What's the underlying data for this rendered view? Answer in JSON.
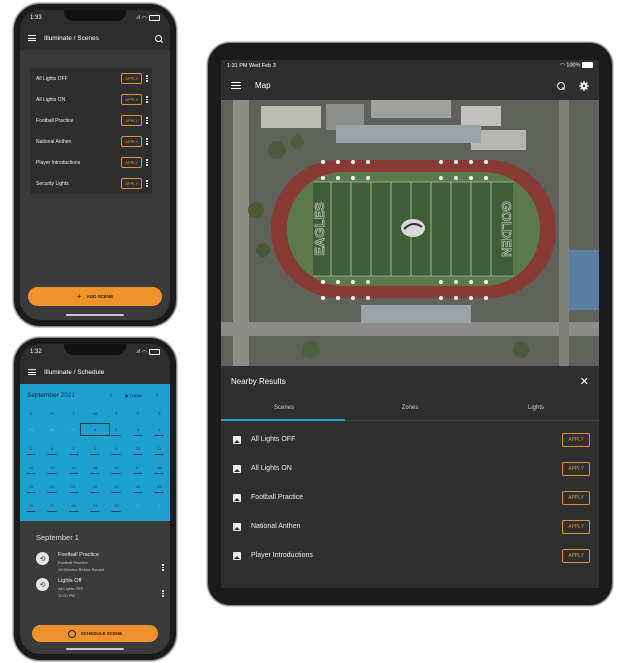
{
  "colors": {
    "accent": "#f0922b",
    "calendar": "#1ea1cf",
    "dark": "#2f2f2f"
  },
  "phone1": {
    "time": "1:33",
    "title": "Illuminate / Scenes",
    "scenes": [
      {
        "label": "All Lights OFF",
        "action": "APPLY"
      },
      {
        "label": "All Lights ON",
        "action": "APPLY"
      },
      {
        "label": "Football Practice",
        "action": "APPLY"
      },
      {
        "label": "National Anthen",
        "action": "APPLY"
      },
      {
        "label": "Player Introductions",
        "action": "APPLY"
      },
      {
        "label": "Security Lights",
        "action": "APPLY"
      }
    ],
    "add_button": "ADD SCENE"
  },
  "phone2": {
    "time": "1:32",
    "title": "Illuminate / Schedule",
    "month": "September",
    "year": "2021",
    "today": "TODAY",
    "weekdays": [
      "S",
      "M",
      "T",
      "W",
      "T",
      "F",
      "S"
    ],
    "weeks": [
      [
        "29",
        "30",
        "31",
        "1",
        "2",
        "3",
        "4"
      ],
      [
        "5",
        "6",
        "7",
        "8",
        "9",
        "10",
        "11"
      ],
      [
        "12",
        "13",
        "14",
        "15",
        "16",
        "17",
        "18"
      ],
      [
        "19",
        "20",
        "21",
        "22",
        "23",
        "24",
        "25"
      ],
      [
        "26",
        "27",
        "28",
        "29",
        "30",
        "1",
        "2"
      ]
    ],
    "day_header": "September 1",
    "events": [
      {
        "title": "Football Practice",
        "scene": "Football Practice",
        "time": "15 Minutes Before Sunset"
      },
      {
        "title": "Lights Off",
        "scene": "All Lights OFF",
        "time": "11:00 PM"
      }
    ],
    "schedule_button": "SCHEDULE SCENE"
  },
  "tablet": {
    "status_time": "1:31 PM  Wed Feb 3",
    "battery": "100%",
    "title": "Map",
    "field_text_left": "EAGLES",
    "field_text_right": "GOLDEN",
    "panel_title": "Nearby Results",
    "tabs": [
      "Scenes",
      "Zones",
      "Lights"
    ],
    "results": [
      {
        "label": "All Lights OFF",
        "action": "APPLY"
      },
      {
        "label": "All Lights ON",
        "action": "APPLY"
      },
      {
        "label": "Football Practice",
        "action": "APPLY"
      },
      {
        "label": "National Anthen",
        "action": "APPLY"
      },
      {
        "label": "Player Introductions",
        "action": "APPLY"
      }
    ]
  }
}
